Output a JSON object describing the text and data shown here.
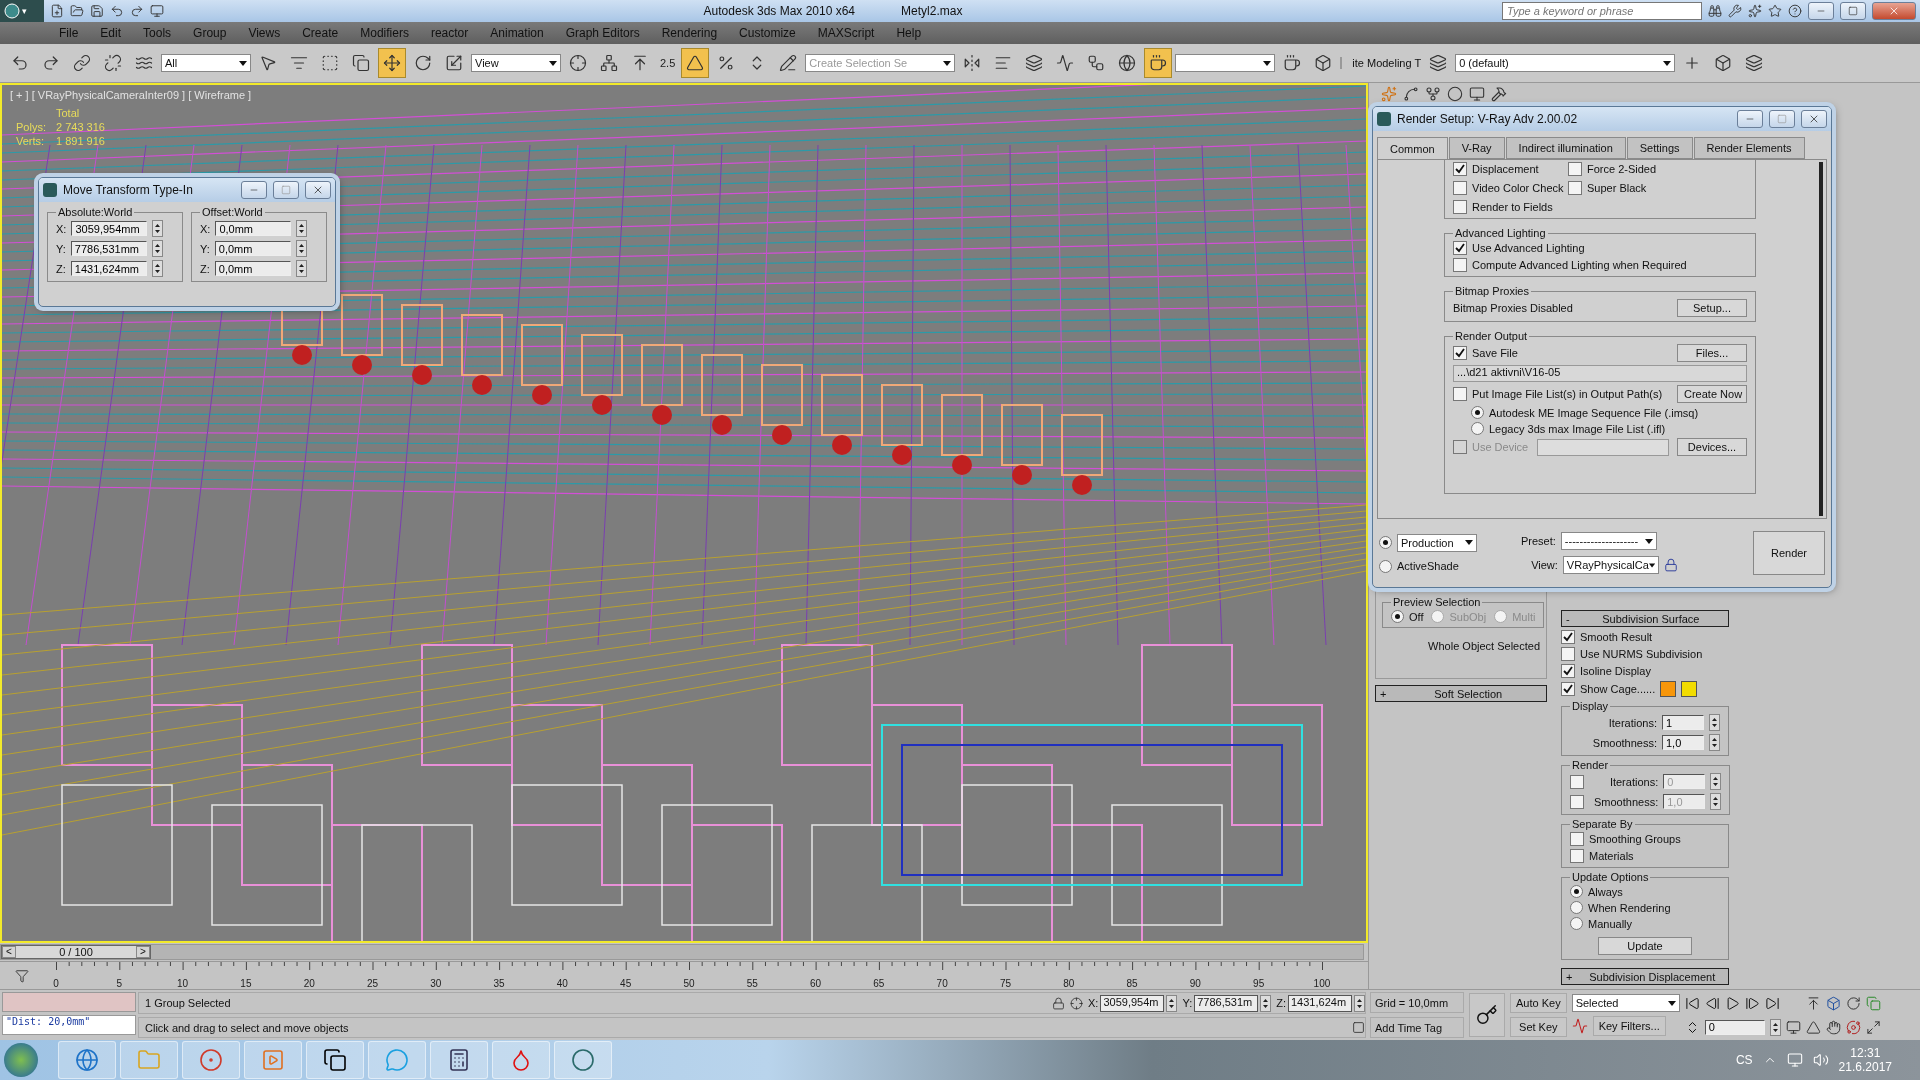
{
  "app_title": {
    "logo_caret": "▾",
    "title": "Autodesk 3ds Max  2010 x64",
    "file": "Metyl2.max",
    "search_placeholder": "Type a keyword or phrase"
  },
  "menu": [
    "File",
    "Edit",
    "Tools",
    "Group",
    "Views",
    "Create",
    "Modifiers",
    "reactor",
    "Animation",
    "Graph Editors",
    "Rendering",
    "Customize",
    "MAXScript",
    "Help"
  ],
  "toolbar": {
    "items": [
      {
        "kind": "tool",
        "selected": false
      },
      {
        "kind": "tool",
        "selected": false
      },
      {
        "kind": "tool",
        "selected": false
      },
      {
        "kind": "tool",
        "selected": false
      },
      {
        "kind": "tool",
        "selected": false
      },
      {
        "kind": "dropdown",
        "value": "All"
      },
      {
        "kind": "tool",
        "selected": false
      },
      {
        "kind": "tool",
        "selected": false
      },
      {
        "kind": "tool",
        "selected": false
      },
      {
        "kind": "tool",
        "selected": false
      },
      {
        "kind": "tool",
        "selected": true
      },
      {
        "kind": "tool",
        "selected": false
      },
      {
        "kind": "tool",
        "selected": false
      },
      {
        "kind": "dropdown",
        "value": "View"
      },
      {
        "kind": "tool",
        "selected": false
      },
      {
        "kind": "tool",
        "selected": false
      },
      {
        "kind": "tool",
        "selected": false
      },
      {
        "kind": "snap",
        "value": "2.5"
      },
      {
        "kind": "tool",
        "selected": true
      },
      {
        "kind": "tool",
        "selected": false
      },
      {
        "kind": "tool",
        "selected": false
      },
      {
        "kind": "tool",
        "selected": false
      },
      {
        "kind": "dropdown",
        "placeholder": "Create Selection Se"
      },
      {
        "kind": "tool",
        "selected": false
      },
      {
        "kind": "tool",
        "selected": false
      },
      {
        "kind": "tool",
        "selected": false
      },
      {
        "kind": "tool",
        "selected": false
      },
      {
        "kind": "tool",
        "selected": false
      },
      {
        "kind": "tool",
        "selected": false
      },
      {
        "kind": "tool",
        "selected": true
      },
      {
        "kind": "dropdown"
      },
      {
        "kind": "tool",
        "selected": false
      },
      {
        "kind": "tool",
        "selected": false
      },
      {
        "kind": "label",
        "value": "ite Modeling T"
      },
      {
        "kind": "tool",
        "selected": false
      },
      {
        "kind": "layer",
        "value": "0 (default)"
      },
      {
        "kind": "tool",
        "selected": false
      },
      {
        "kind": "tool",
        "selected": false
      },
      {
        "kind": "tool",
        "selected": false
      }
    ]
  },
  "viewport": {
    "label": "[ + ] [ VRayPhysicalCameraInter09 ] [ Wireframe ]",
    "stats_header": "Total",
    "stats": [
      {
        "label": "Polys:",
        "value": "2 743 316"
      },
      {
        "label": "Verts:",
        "value": "1 891 916"
      }
    ]
  },
  "move_dialog": {
    "title": "Move Transform Type-In",
    "groups": [
      {
        "title": "Absolute:World",
        "fields": [
          {
            "axis": "X:",
            "value": "3059,954mm"
          },
          {
            "axis": "Y:",
            "value": "7786,531mm"
          },
          {
            "axis": "Z:",
            "value": "1431,624mm"
          }
        ]
      },
      {
        "title": "Offset:World",
        "fields": [
          {
            "axis": "X:",
            "value": "0,0mm"
          },
          {
            "axis": "Y:",
            "value": "0,0mm"
          },
          {
            "axis": "Z:",
            "value": "0,0mm"
          }
        ]
      }
    ]
  },
  "render_setup": {
    "title": "Render Setup: V-Ray Adv 2.00.02",
    "tabs": [
      {
        "label": "Common",
        "selected": true
      },
      {
        "label": "V-Ray",
        "selected": false
      },
      {
        "label": "Indirect illumination",
        "selected": false
      },
      {
        "label": "Settings",
        "selected": false
      },
      {
        "label": "Render Elements",
        "selected": false
      }
    ],
    "options": [
      {
        "label": "Displacement",
        "checked": true
      },
      {
        "label": "Force 2-Sided",
        "checked": false
      },
      {
        "label": "Video Color Check",
        "checked": false
      },
      {
        "label": "Super Black",
        "checked": false
      },
      {
        "label": "Render to Fields",
        "checked": false
      }
    ],
    "advanced_lighting": {
      "title": "Advanced Lighting",
      "options": [
        {
          "label": "Use Advanced Lighting",
          "checked": true
        },
        {
          "label": "Compute Advanced Lighting when Required",
          "checked": false
        }
      ]
    },
    "bitmap_proxies": {
      "title": "Bitmap Proxies",
      "status": "Bitmap Proxies Disabled",
      "button": "Setup..."
    },
    "render_output": {
      "title": "Render Output",
      "save_file": {
        "label": "Save File",
        "checked": true
      },
      "files_button": "Files...",
      "path": "...\\d21 aktivni\\V16-05",
      "put_list": {
        "label": "Put Image File List(s) in Output Path(s)",
        "checked": false
      },
      "create_button": "Create Now",
      "formats": [
        {
          "label": "Autodesk ME Image Sequence File (.imsq)",
          "selected": true
        },
        {
          "label": "Legacy 3ds max Image File List (.ifl)",
          "selected": false
        }
      ],
      "use_device": {
        "label": "Use Device",
        "checked": false,
        "disabled": true
      },
      "devices_button": "Devices..."
    },
    "modes": [
      {
        "label": "Production",
        "selected": true
      },
      {
        "label": "ActiveShade",
        "selected": false
      }
    ],
    "preset_label": "Preset:",
    "preset": "--------------------",
    "view_label": "View:",
    "view": "VRayPhysicalCa",
    "render_button": "Render"
  },
  "command_panel": {
    "preview_selection": {
      "title": "Preview Selection",
      "options": [
        {
          "label": "Off",
          "selected": true,
          "disabled": false
        },
        {
          "label": "SubObj",
          "selected": false,
          "disabled": true
        },
        {
          "label": "Multi",
          "selected": false,
          "disabled": true
        }
      ]
    },
    "selection_status": "Whole Object Selected",
    "soft_selection": {
      "toggle": "+",
      "label": "Soft Selection"
    },
    "subdivision_surface": {
      "toggle": "-",
      "label": "Subdivision Surface",
      "options": [
        {
          "label": "Smooth Result",
          "checked": true
        },
        {
          "label": "Use NURMS Subdivision",
          "checked": false
        },
        {
          "label": "Isoline Display",
          "checked": true
        },
        {
          "label": "Show Cage......",
          "checked": true
        }
      ],
      "cage_colors": [
        {
          "color": "#f7960a"
        },
        {
          "color": "#f2dc00"
        }
      ],
      "display": {
        "title": "Display",
        "fields": [
          {
            "label": "Iterations:",
            "value": "1"
          },
          {
            "label": "Smoothness:",
            "value": "1,0"
          }
        ]
      },
      "render": {
        "title": "Render",
        "fields": [
          {
            "label": "Iterations:",
            "value": "0",
            "checked": false
          },
          {
            "label": "Smoothness:",
            "value": "1,0",
            "checked": false
          }
        ]
      },
      "separate_by": {
        "title": "Separate By",
        "options": [
          {
            "label": "Smoothing Groups",
            "checked": false
          },
          {
            "label": "Materials",
            "checked": false
          }
        ]
      },
      "update_options": {
        "title": "Update Options",
        "options": [
          {
            "label": "Always",
            "selected": true
          },
          {
            "label": "When Rendering",
            "selected": false
          },
          {
            "label": "Manually",
            "selected": false
          }
        ],
        "button": "Update"
      }
    },
    "subdivision_displacement": {
      "toggle": "+",
      "label": "Subdivision Displacement"
    }
  },
  "timeline": {
    "prev": "<",
    "position": "0 / 100",
    "level": 0,
    "next": ">",
    "ticks": [
      "0",
      "5",
      "10",
      "15",
      "20",
      "25",
      "30",
      "35",
      "40",
      "45",
      "50",
      "55",
      "60",
      "65",
      "70",
      "75",
      "80",
      "85",
      "90",
      "95",
      "100"
    ]
  },
  "status": {
    "listener_output": "\"Dist: 20,0mm\"",
    "selection": "1 Group Selected",
    "prompt": "Click and drag to select and move objects",
    "coords": [
      {
        "axis": "X:",
        "value": "3059,954m"
      },
      {
        "axis": "Y:",
        "value": "7786,531m"
      },
      {
        "axis": "Z:",
        "value": "1431,624m"
      }
    ],
    "grid": "Grid = 10,0mm",
    "time_tag": "Add Time Tag",
    "auto_key": "Auto Key",
    "set_key": "Set Key",
    "key_mode": "Selected",
    "key_filters": "Key Filters...",
    "frame": "0"
  },
  "taskbar": {
    "language": "CS",
    "time": "12:31",
    "date": "21.6.2017"
  }
}
